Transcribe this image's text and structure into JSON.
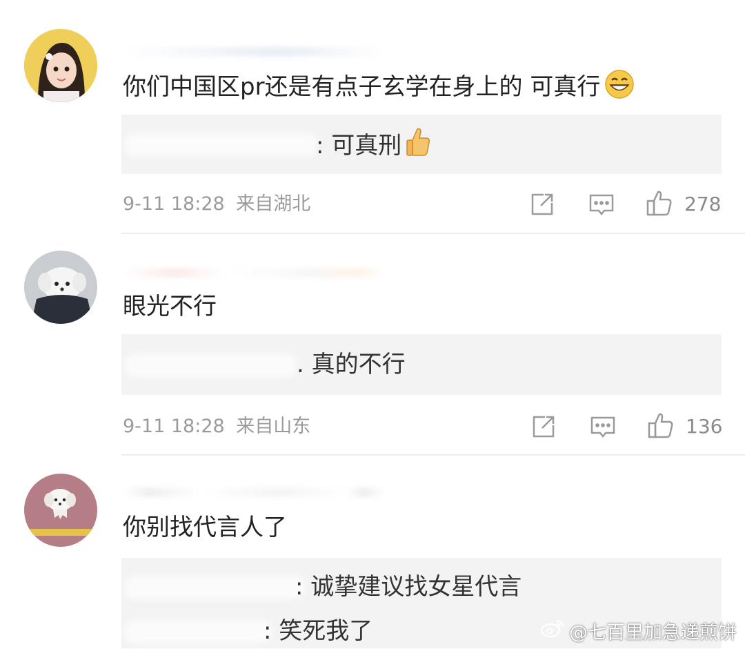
{
  "comments": [
    {
      "content": "你们中国区pr还是有点子玄学在身上的 可真行",
      "replies": [
        {
          "suffix": ": 可真刑"
        }
      ],
      "timestamp": "9-11 18:28",
      "location": "来自湖北",
      "likes": "278"
    },
    {
      "content": "眼光不行",
      "replies": [
        {
          "suffix": ". 真的不行"
        }
      ],
      "timestamp": "9-11 18:28",
      "location": "来自山东",
      "likes": "136"
    },
    {
      "content": "你别找代言人了",
      "replies": [
        {
          "suffix": ": 诚挚建议找女星代言"
        },
        {
          "suffix": ": 笑死我了"
        }
      ]
    }
  ],
  "icons": {
    "share": "share-icon",
    "comment": "comment-icon",
    "like": "thumbs-up-icon",
    "grin": "grin-emoji-icon",
    "thumb_emoji": "thumbs-up-emoji-icon"
  },
  "watermark": {
    "text": "@七百里加急递煎饼"
  },
  "colors": {
    "reply_bg": "#f3f3f3",
    "meta_text": "#9a9a9a",
    "divider": "#ededed"
  }
}
